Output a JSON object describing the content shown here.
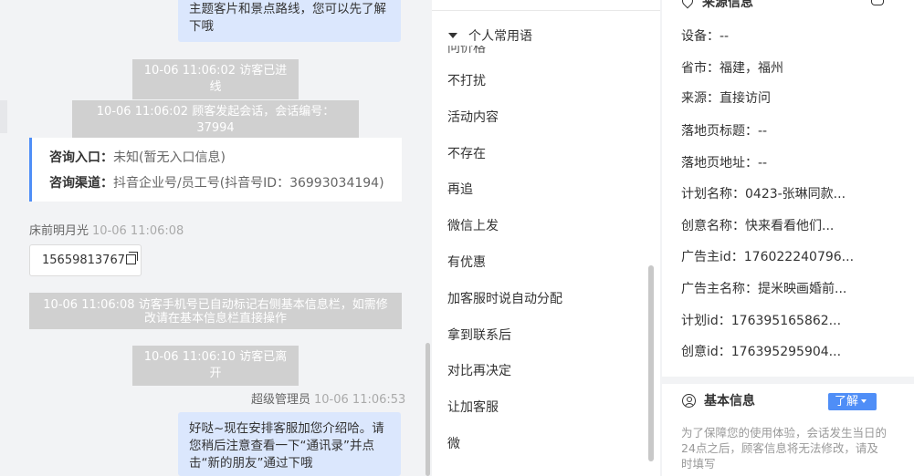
{
  "chat": {
    "msg_top": "主题客片和景点路线，您可以先了解下哦",
    "sys1": "10-06 11:06:02 访客已进线",
    "sys2": "10-06 11:06:02 顾客发起会话，会话编号：37994",
    "inquiry_entry_label": "咨询入口：",
    "inquiry_entry_value": "未知(暂无入口信息)",
    "inquiry_channel_label": "咨询渠道：",
    "inquiry_channel_value": "抖音企业号/员工号(抖音号ID：36993034194)",
    "visitor_name": "床前明月光",
    "visitor_time": "10-06 11:06:08",
    "visitor_phone": "15659813767",
    "sys3": "10-06 11:06:08 访客手机号已自动标记右侧基本信息栏，如需修改请在基本信息栏直接操作",
    "sys4": "10-06 11:06:10 访客已离开",
    "agent_name": "超级管理员",
    "agent_time": "10-06 11:06:53",
    "msg_bottom": "好哒~现在安排客服加您介绍哈。请您稍后注意查看一下“通讯录”并点击“新的朋友”通过下哦"
  },
  "phrases": {
    "ghost_item": "问价格",
    "group_label": "个人常用语",
    "items": [
      "不打扰",
      "活动内容",
      "不存在",
      "再追",
      "微信上发",
      "有优惠",
      "加客服时说自动分配",
      "拿到联系后",
      "对比再决定",
      "让加客服",
      "微"
    ]
  },
  "source": {
    "title": "来源信息",
    "fields": [
      "设备：--",
      "省市：福建，福州",
      "来源：直接访问",
      "落地页标题：--",
      "落地页地址：--",
      "计划名称：0423-张琳同款...",
      "创意名称：快来看看他们...",
      "广告主id：176022240796...",
      "广告主名称：提米映画婚前...",
      "计划id：176395165862...",
      "创意id：176395295904..."
    ],
    "basic_title": "基本信息",
    "learn_label": "了解",
    "notice": "为了保障您的使用体验，会话发生当日的24点之后，顾客信息将无法修改，请及时填写"
  }
}
